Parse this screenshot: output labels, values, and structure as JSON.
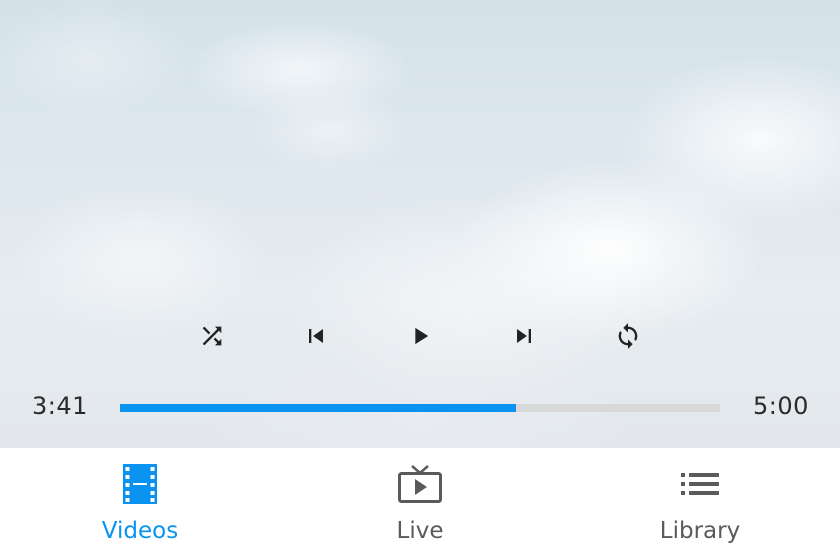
{
  "player": {
    "background": "sky-with-clouds",
    "controls": [
      {
        "name": "shuffle-button",
        "icon": "shuffle-icon"
      },
      {
        "name": "previous-button",
        "icon": "skip-previous-icon"
      },
      {
        "name": "play-button",
        "icon": "play-icon"
      },
      {
        "name": "next-button",
        "icon": "skip-next-icon"
      },
      {
        "name": "repeat-button",
        "icon": "repeat-icon"
      }
    ],
    "current_time": "3:41",
    "duration": "5:00",
    "progress_fraction": 0.66,
    "progress_color": "#0a93f0",
    "track_color": "#d9d9d9"
  },
  "tabbar": {
    "tabs": [
      {
        "label": "Videos",
        "icon": "film-icon",
        "active": true
      },
      {
        "label": "Live",
        "icon": "tv-icon",
        "active": false
      },
      {
        "label": "Library",
        "icon": "list-icon",
        "active": false
      }
    ],
    "active_color": "#0a93f0",
    "inactive_color": "#5a5a5a"
  }
}
